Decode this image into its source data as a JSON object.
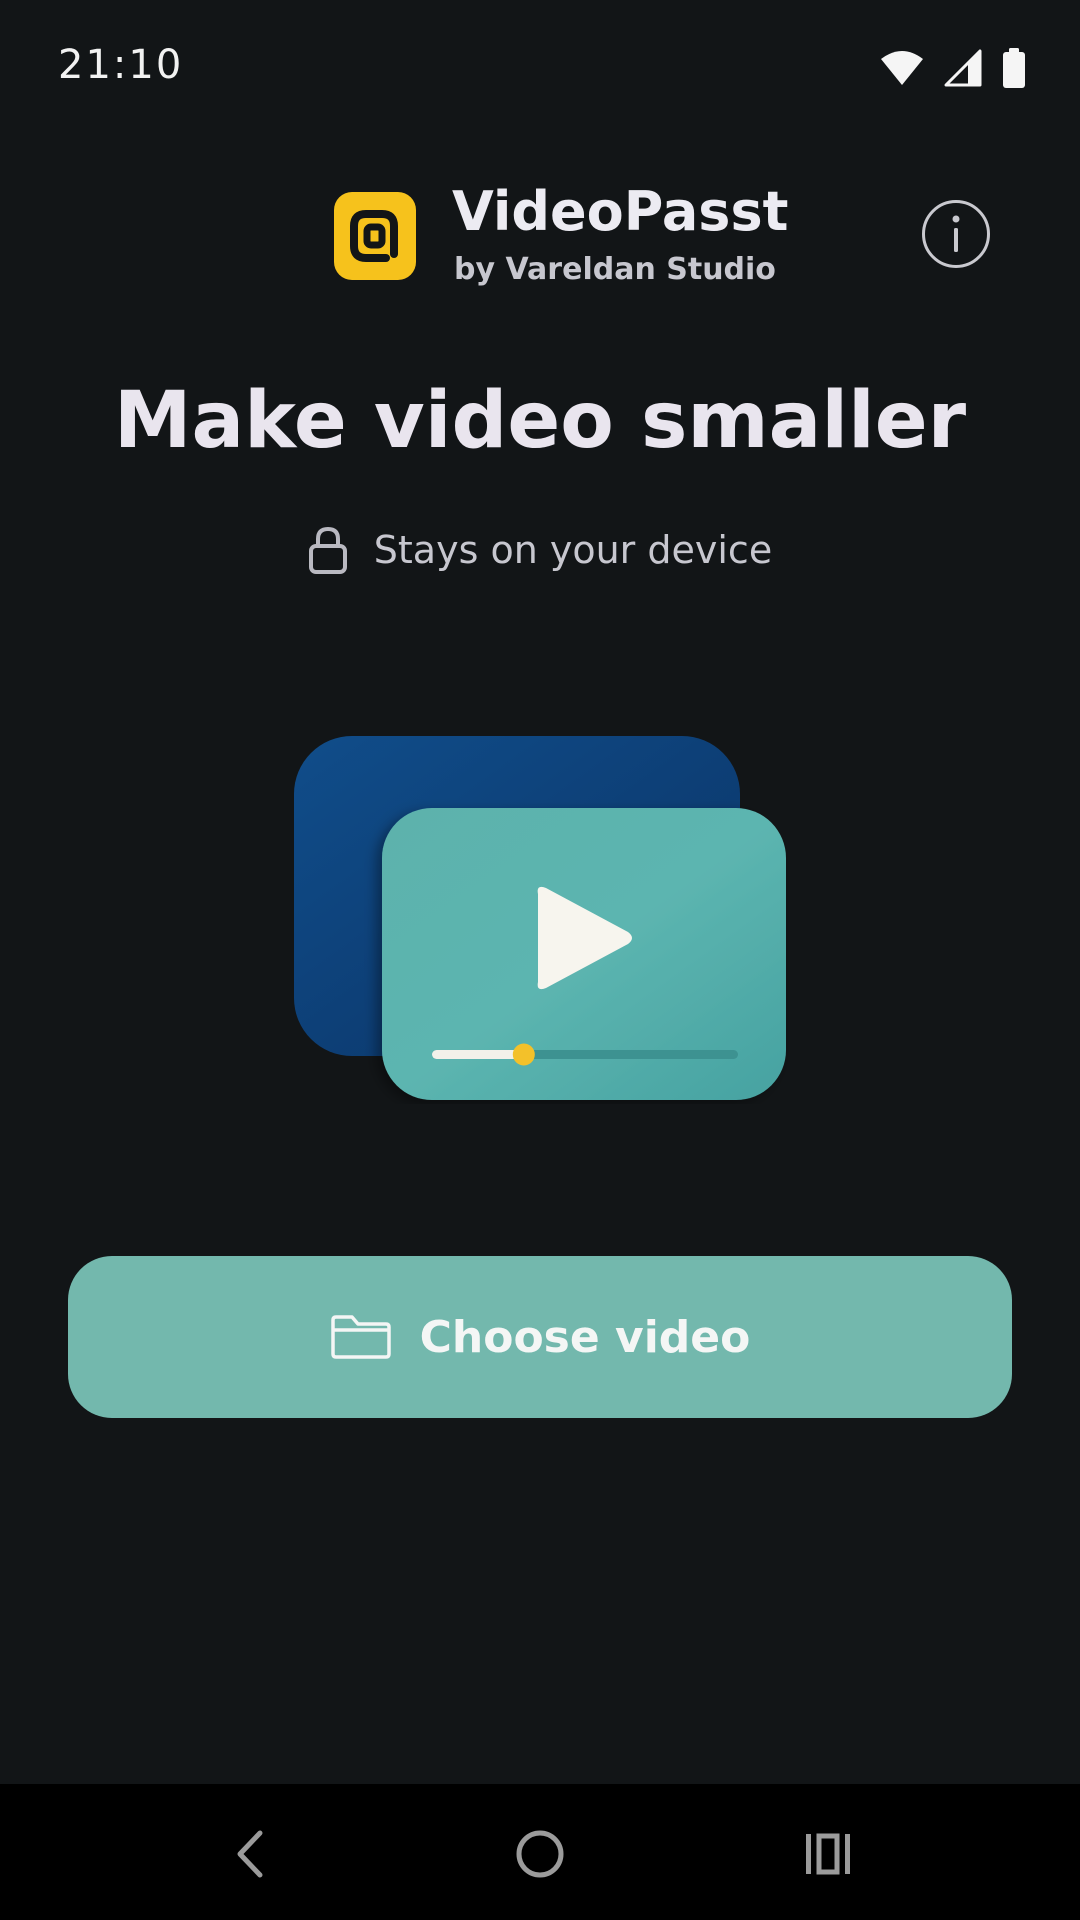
{
  "status_bar": {
    "time": "21:10",
    "icons": [
      "wifi-icon",
      "cell-signal-icon",
      "battery-icon"
    ]
  },
  "header": {
    "app_name": "VideoPasst",
    "byline": "by Vareldan Studio",
    "logo_icon": "app-logo-icon",
    "info_icon": "info-icon"
  },
  "main": {
    "headline": "Make video smaller",
    "privacy_note": "Stays on your device",
    "privacy_icon": "lock-icon",
    "illustration_icon": "video-player-icon",
    "illustration_progress": 0.3
  },
  "actions": {
    "choose_label": "Choose video",
    "choose_icon": "folder-icon"
  },
  "navigation": {
    "items": [
      "back-icon",
      "home-icon",
      "recents-icon"
    ]
  },
  "colors": {
    "background": "#121517",
    "accent": "#73b8ad",
    "logo": "#f6c21c",
    "back_card": "#0d3f74",
    "front_card": "#5fb3ad",
    "slider_thumb": "#f3c12a"
  }
}
